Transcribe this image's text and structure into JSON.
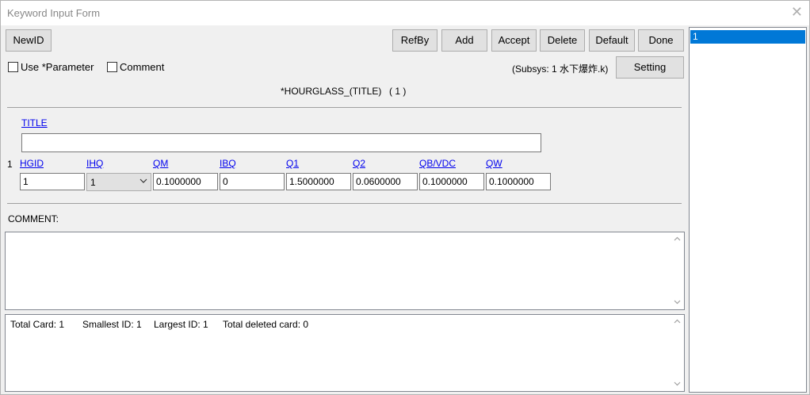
{
  "window": {
    "title": "Keyword Input Form",
    "close_glyph": "✕"
  },
  "toolbar": {
    "newid": "NewID",
    "refby": "RefBy",
    "add": "Add",
    "accept": "Accept",
    "delete": "Delete",
    "default": "Default",
    "done": "Done",
    "setting": "Setting"
  },
  "options": {
    "use_parameter": "Use *Parameter",
    "comment": "Comment",
    "subsys": "(Subsys: 1 水下爆炸.k)"
  },
  "keyword": {
    "name": "*HOURGLASS_(TITLE)",
    "count": "( 1 )"
  },
  "title_field": {
    "label": "TITLE",
    "value": ""
  },
  "card": {
    "row_number": "1",
    "fields": [
      {
        "label": "HGID",
        "value": "1"
      },
      {
        "label": "IHQ",
        "value": "1"
      },
      {
        "label": "QM",
        "value": "0.1000000"
      },
      {
        "label": "IBQ",
        "value": "0"
      },
      {
        "label": "Q1",
        "value": "1.5000000"
      },
      {
        "label": "Q2",
        "value": "0.0600000"
      },
      {
        "label": "QB/VDC",
        "value": "0.1000000"
      },
      {
        "label": "QW",
        "value": "0.1000000"
      }
    ]
  },
  "comment_section": {
    "label": "COMMENT:"
  },
  "status": {
    "total_card": "Total Card: 1",
    "smallest_id": "Smallest ID: 1",
    "largest_id": "Largest ID: 1",
    "total_deleted": "Total deleted card:  0"
  },
  "id_list": {
    "items": [
      "1"
    ]
  },
  "icons": {
    "dropdown": "chevron-down-icon",
    "scroll_up": "scroll-up-icon",
    "scroll_down": "scroll-down-icon"
  }
}
